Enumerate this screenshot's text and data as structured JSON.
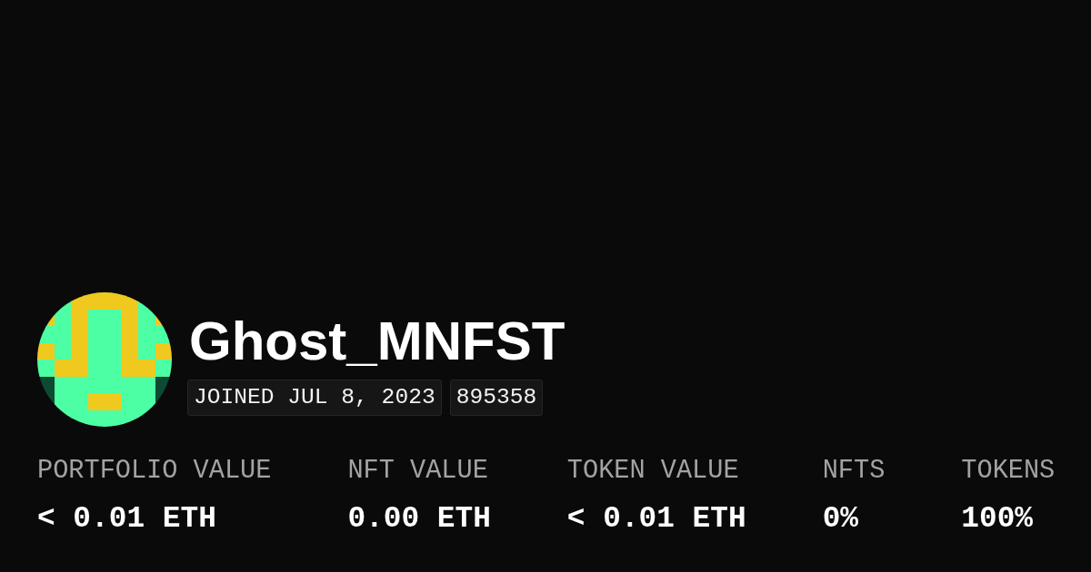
{
  "profile": {
    "name": "Ghost_MNFST",
    "tags": [
      "JOINED JUL 8, 2023",
      "895358"
    ]
  },
  "stats": [
    {
      "label": "PORTFOLIO VALUE",
      "value": "< 0.01 ETH"
    },
    {
      "label": "NFT VALUE",
      "value": "0.00 ETH"
    },
    {
      "label": "TOKEN VALUE",
      "value": "< 0.01 ETH"
    },
    {
      "label": "NFTS",
      "value": "0%"
    },
    {
      "label": "TOKENS",
      "value": "100%"
    }
  ]
}
